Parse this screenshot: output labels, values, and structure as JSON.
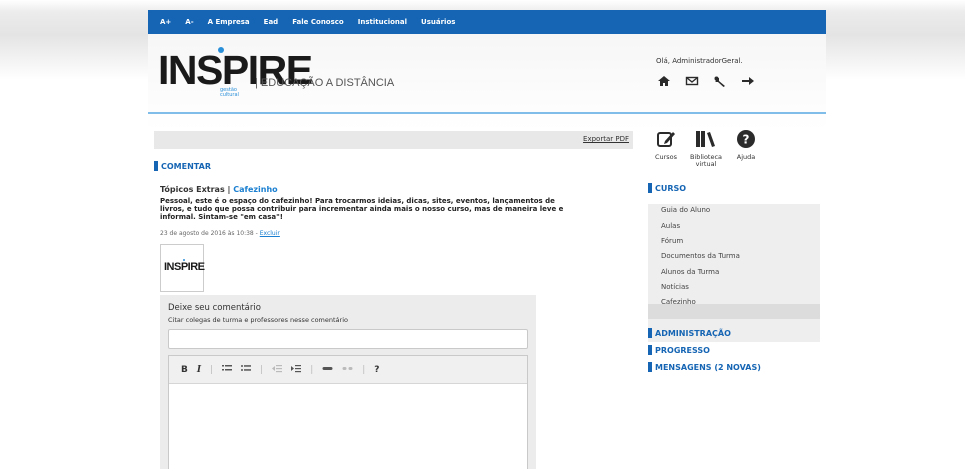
{
  "topnav": {
    "items": [
      "A+",
      "A-",
      "A Empresa",
      "Ead",
      "Fale Conosco",
      "Institucional",
      "Usuários"
    ]
  },
  "brand": {
    "logo_text": "INSPIRE",
    "logo_sub_1": "gestão",
    "logo_sub_2": "cultural",
    "tagline": "| EDUCAÇÃO A DISTÂNCIA"
  },
  "user": {
    "greeting": "Olá, AdministradorGeral.",
    "icons": [
      "home-icon",
      "mail-icon",
      "wrench-icon",
      "logout-arrow-icon"
    ]
  },
  "toolbar": {
    "export_label": "Exportar PDF"
  },
  "tools": [
    {
      "label_1": "Cursos",
      "label_2": "",
      "icon": "pencil-square-icon"
    },
    {
      "label_1": "Biblioteca",
      "label_2": "virtual",
      "icon": "books-icon"
    },
    {
      "label_1": "Ajuda",
      "label_2": "",
      "icon": "help-icon"
    }
  ],
  "main": {
    "section_title": "COMENTAR",
    "post": {
      "prefix": "Tópicos Extras | ",
      "category": "Cafezinho",
      "text": "Pessoal, este é o espaço do cafezinho! Para trocarmos ideias, dicas, sites, eventos, lançamentos de livros, e tudo que possa contribuir para incrementar ainda mais o nosso curso, mas de maneira leve e informal. Sintam-se \"em casa\"!",
      "meta": "23 de agosto de 2016 às 10:38 - ",
      "delete_label": "Excluir",
      "thumb_text": "INSPIRE"
    },
    "comment": {
      "title": "Deixe seu comentário",
      "subtitle": "Citar colegas de turma e professores nesse comentário",
      "input_value": "",
      "tools": [
        "B",
        "I",
        "ordered-list-icon",
        "bullet-list-icon",
        "outdent-icon",
        "indent-icon",
        "link-icon",
        "unlink-icon",
        "?"
      ]
    }
  },
  "sidebar": {
    "curso_title": "CURSO",
    "items": [
      "Guia do Aluno",
      "Aulas",
      "Fórum",
      "Documentos da Turma",
      "Alunos da Turma",
      "Notícias",
      "Cafezinho"
    ],
    "active_item": "Cafezinho",
    "admin_title": "ADMINISTRAÇÃO",
    "progress_title": "PROGRESSO",
    "messages_title": "MENSAGENS (2 NOVAS)"
  },
  "colors": {
    "nav_blue": "#1565b4",
    "accent_blue": "#1a7fd0",
    "logo_blue": "#2a8fd9"
  }
}
